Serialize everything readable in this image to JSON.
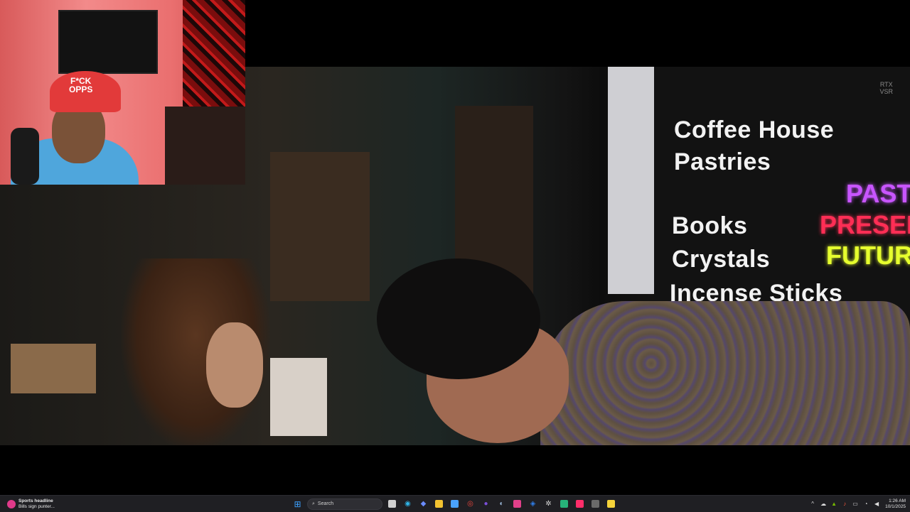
{
  "video": {
    "badge": [
      "RTX",
      "VSR"
    ],
    "window_signs": [
      "Coffee House",
      "Pastries",
      "Books",
      "Crystals",
      "Incense Sticks"
    ],
    "neon_signs": [
      {
        "text": "PAST",
        "color": "#c855ff"
      },
      {
        "text": "PRESEN",
        "color": "#ff2e55"
      },
      {
        "text": "FUTUR",
        "color": "#e6ff2e"
      }
    ]
  },
  "webcam": {
    "cap_text": [
      "F*CK",
      "OPPS"
    ]
  },
  "taskbar": {
    "weather": {
      "headline": "Sports headline",
      "subline": "Bills sign punter..."
    },
    "search_placeholder": "Search",
    "apps": [
      {
        "name": "start",
        "glyph": "▦",
        "color": "#3ba0ff"
      },
      {
        "name": "task-view",
        "glyph": "▣",
        "color": "#d0d0d0"
      },
      {
        "name": "edge",
        "glyph": "◉",
        "color": "#2fb5e8"
      },
      {
        "name": "copilot",
        "glyph": "◆",
        "color": "#6a8cff"
      },
      {
        "name": "file-explorer",
        "glyph": "▬",
        "color": "#f2c230"
      },
      {
        "name": "store",
        "glyph": "▤",
        "color": "#4aa3ff"
      },
      {
        "name": "chrome",
        "glyph": "◎",
        "color": "#e8453c"
      },
      {
        "name": "app-purple",
        "glyph": "●",
        "color": "#7a4fd8"
      },
      {
        "name": "steam",
        "glyph": "◐",
        "color": "#9ab8d8"
      },
      {
        "name": "instagram",
        "glyph": "◘",
        "color": "#e0408a"
      },
      {
        "name": "app-blue",
        "glyph": "◈",
        "color": "#2f7de8"
      },
      {
        "name": "settings",
        "glyph": "✲",
        "color": "#d8d8d8"
      },
      {
        "name": "app-green",
        "glyph": "◼",
        "color": "#27b37a"
      },
      {
        "name": "tiktok",
        "glyph": "♪",
        "color": "#ff2d6a"
      },
      {
        "name": "app-gray",
        "glyph": "▭",
        "color": "#9a9a9a"
      },
      {
        "name": "sticky-notes",
        "glyph": "▪",
        "color": "#f5d33a"
      }
    ],
    "tray_icons": [
      "^",
      "☁",
      "▲",
      "♪",
      "▭",
      "◔",
      "✉",
      "🔊"
    ],
    "time": "1:26 AM",
    "date": "10/1/2025"
  }
}
